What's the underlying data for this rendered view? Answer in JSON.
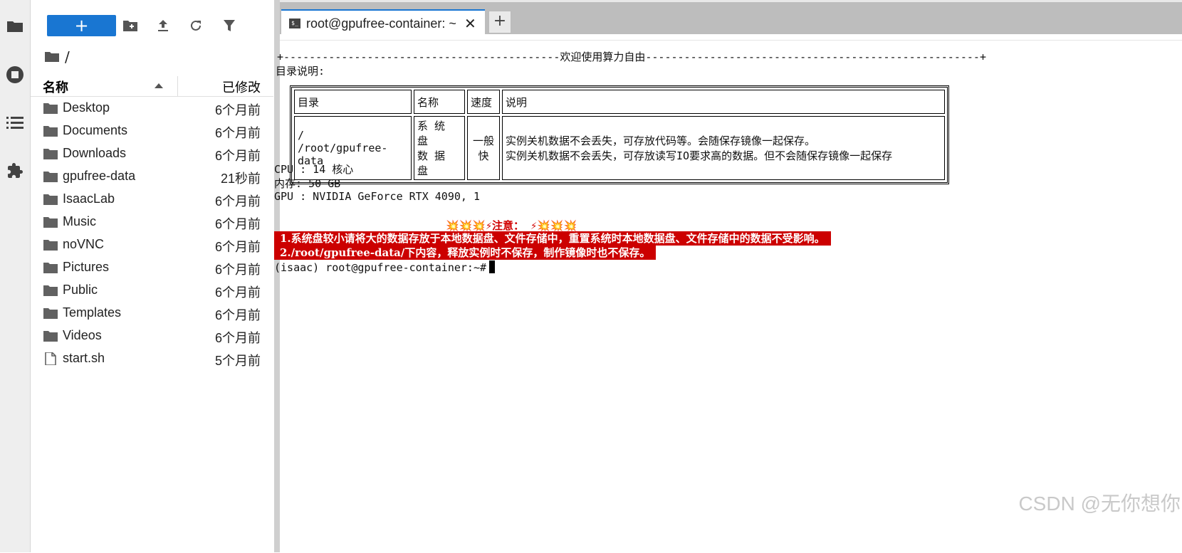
{
  "toolbar": {
    "new_label": "+"
  },
  "breadcrumb": "/",
  "list_header": {
    "name": "名称",
    "modified": "已修改"
  },
  "files": [
    {
      "name": "Desktop",
      "modified": "6个月前",
      "type": "folder"
    },
    {
      "name": "Documents",
      "modified": "6个月前",
      "type": "folder"
    },
    {
      "name": "Downloads",
      "modified": "6个月前",
      "type": "folder"
    },
    {
      "name": "gpufree-data",
      "modified": "21秒前",
      "type": "folder"
    },
    {
      "name": "IsaacLab",
      "modified": "6个月前",
      "type": "folder"
    },
    {
      "name": "Music",
      "modified": "6个月前",
      "type": "folder"
    },
    {
      "name": "noVNC",
      "modified": "6个月前",
      "type": "folder"
    },
    {
      "name": "Pictures",
      "modified": "6个月前",
      "type": "folder"
    },
    {
      "name": "Public",
      "modified": "6个月前",
      "type": "folder"
    },
    {
      "name": "Templates",
      "modified": "6个月前",
      "type": "folder"
    },
    {
      "name": "Videos",
      "modified": "6个月前",
      "type": "folder"
    },
    {
      "name": "start.sh",
      "modified": "5个月前",
      "type": "file"
    }
  ],
  "tab": {
    "icon_text": "$_",
    "title": "root@gpufree-container: ~",
    "close": "✕",
    "add": "+"
  },
  "terminal": {
    "banner": "+-------------------------------------------欢迎使用算力自由----------------------------------------------------+",
    "dir_heading": "目录说明:",
    "table": {
      "headers": [
        "目录",
        "名称",
        "速度",
        "说明"
      ],
      "dir": [
        "/",
        "/root/gpufree-data"
      ],
      "name": [
        "系 统 盘",
        "数 据 盘"
      ],
      "speed": [
        "一般",
        "快"
      ],
      "desc": [
        "实例关机数据不会丢失，可存放代码等。会随保存镜像一起保存。",
        "实例关机数据不会丢失，可存放读写IO要求高的数据。但不会随保存镜像一起保存"
      ]
    },
    "cpu": "CPU : 14 核心",
    "mem": "内存: 50 GB",
    "gpu": "GPU : NVIDIA GeForce RTX 4090, 1",
    "notice": "💥💥💥⚡注意： ⚡💥💥💥",
    "warn1": "1.系统盘较小请将大的数据存放于本地数据盘、文件存储中，重置系统时本地数据盘、文件存储中的数据不受影响。",
    "warn2": "2./root/gpufree-data/下内容，释放实例时不保存，制作镜像时也不保存。",
    "prompt": "(isaac) root@gpufree-container:~#"
  },
  "watermark": "CSDN @无你想你",
  "colors": {
    "accent": "#1976d2",
    "warning_bg": "#cc0000"
  }
}
